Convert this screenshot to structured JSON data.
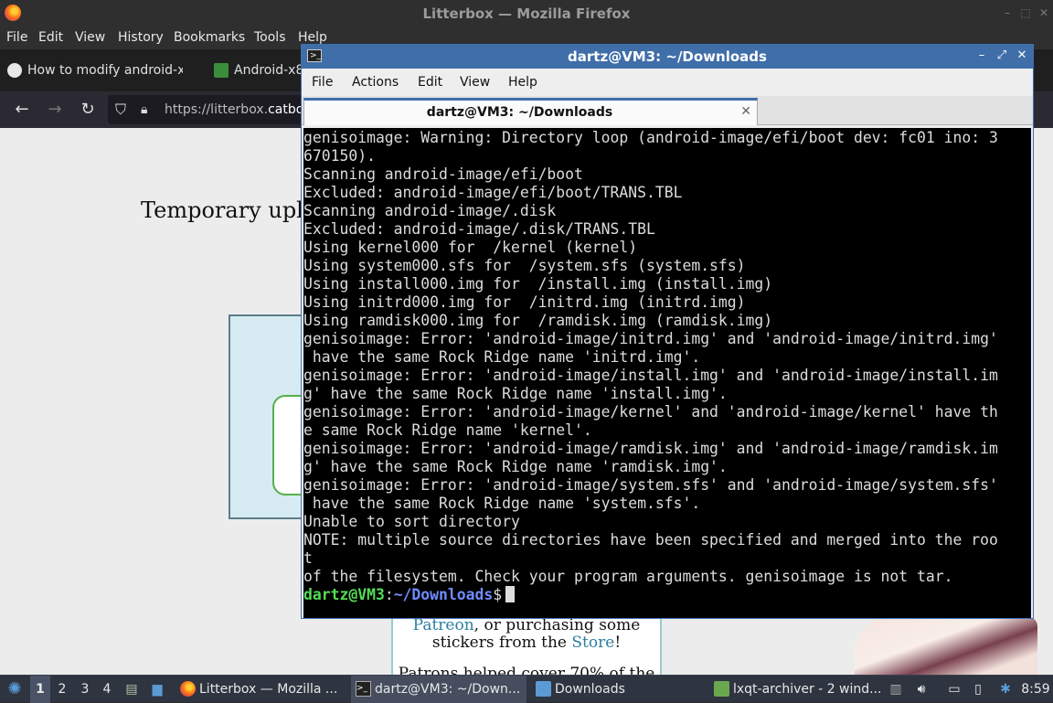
{
  "firefox": {
    "title": "Litterbox — Mozilla Firefox",
    "menu": [
      "File",
      "Edit",
      "View",
      "History",
      "Bookmarks",
      "Tools",
      "Help"
    ],
    "tabs": [
      "How to modify android-x",
      "Android-x8"
    ],
    "url_prefix": "https://litterbox.",
    "url_domain": "catbo",
    "page_heading": "Temporary upl",
    "support_line1_link": "Patreon",
    "support_line1_rest": ", or purchasing some",
    "support_line2_pre": "stickers from the ",
    "support_line2_link": "Store",
    "support_line2_post": "!",
    "support_line3": "Patrons helped cover 70% of the"
  },
  "terminal": {
    "title": "dartz@VM3: ~/Downloads",
    "menu": [
      "File",
      "Actions",
      "Edit",
      "View",
      "Help"
    ],
    "tab_label": "dartz@VM3: ~/Downloads",
    "lines": [
      "genisoimage: Warning: Directory loop (android-image/efi/boot dev: fc01 ino: 3",
      "670150).",
      "Scanning android-image/efi/boot",
      "Excluded: android-image/efi/boot/TRANS.TBL",
      "Scanning android-image/.disk",
      "Excluded: android-image/.disk/TRANS.TBL",
      "Using kernel000 for  /kernel (kernel)",
      "Using system000.sfs for  /system.sfs (system.sfs)",
      "Using install000.img for  /install.img (install.img)",
      "Using initrd000.img for  /initrd.img (initrd.img)",
      "Using ramdisk000.img for  /ramdisk.img (ramdisk.img)",
      "genisoimage: Error: 'android-image/initrd.img' and 'android-image/initrd.img'",
      " have the same Rock Ridge name 'initrd.img'.",
      "genisoimage: Error: 'android-image/install.img' and 'android-image/install.im",
      "g' have the same Rock Ridge name 'install.img'.",
      "genisoimage: Error: 'android-image/kernel' and 'android-image/kernel' have th",
      "e same Rock Ridge name 'kernel'.",
      "genisoimage: Error: 'android-image/ramdisk.img' and 'android-image/ramdisk.im",
      "g' have the same Rock Ridge name 'ramdisk.img'.",
      "genisoimage: Error: 'android-image/system.sfs' and 'android-image/system.sfs'",
      " have the same Rock Ridge name 'system.sfs'.",
      "Unable to sort directory",
      "NOTE: multiple source directories have been specified and merged into the roo",
      "t",
      "of the filesystem. Check your program arguments. genisoimage is not tar."
    ],
    "prompt_user": "dartz@VM3",
    "prompt_sep": ":",
    "prompt_path": "~/Downloads",
    "prompt_symbol": "$"
  },
  "taskbar": {
    "desktops": [
      "1",
      "2",
      "3",
      "4"
    ],
    "active_desktop": "1",
    "tasks": [
      "Litterbox — Mozilla ...",
      "dartz@VM3: ~/Down...",
      "Downloads",
      "lxqt-archiver - 2 wind..."
    ],
    "clock": "8:59"
  },
  "colors": {
    "terminal_title_bg": "#3f6ea9",
    "prompt_user": "#55dd55",
    "prompt_path": "#6f8cff",
    "taskbar_bg": "#2e3440"
  }
}
